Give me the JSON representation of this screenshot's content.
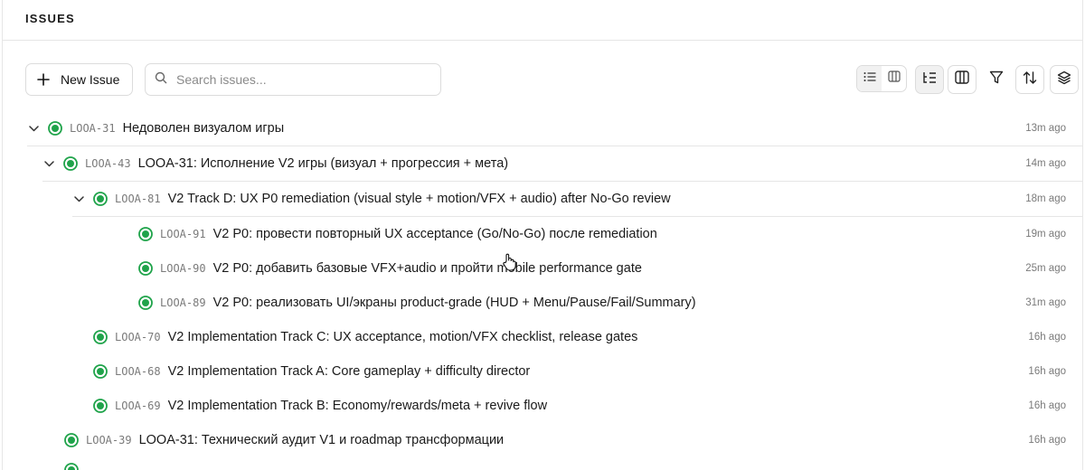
{
  "header": {
    "title": "ISSUES"
  },
  "toolbar": {
    "new_issue_label": "New Issue",
    "search_placeholder": "Search issues...",
    "icons": [
      "plus-icon",
      "search-icon",
      "list-view-icon",
      "board-view-icon",
      "nested-view-icon",
      "columns-icon",
      "filter-icon",
      "sort-icon",
      "layers-icon"
    ]
  },
  "colors": {
    "status_green": "#1fa34a",
    "border": "#e6e6e6",
    "muted": "#7a7a7a"
  },
  "issues": [
    {
      "id": "LOOA-31",
      "title": "Недоволен визуалом игры",
      "time": "13m ago",
      "expanded": true
    },
    {
      "id": "LOOA-43",
      "title": "LOOA-31: Исполнение V2 игры (визуал + прогрессия + мета)",
      "time": "14m ago",
      "expanded": true
    },
    {
      "id": "LOOA-81",
      "title": "V2 Track D: UX P0 remediation (visual style + motion/VFX + audio) after No-Go review",
      "time": "18m ago",
      "expanded": true
    },
    {
      "id": "LOOA-91",
      "title": "V2 P0: провести повторный UX acceptance (Go/No-Go) после remediation",
      "time": "19m ago"
    },
    {
      "id": "LOOA-90",
      "title": "V2 P0: добавить базовые VFX+audio и пройти mobile performance gate",
      "time": "25m ago"
    },
    {
      "id": "LOOA-89",
      "title": "V2 P0: реализовать UI/экраны product-grade (HUD + Menu/Pause/Fail/Summary)",
      "time": "31m ago"
    },
    {
      "id": "LOOA-70",
      "title": "V2 Implementation Track C: UX acceptance, motion/VFX checklist, release gates",
      "time": "16h ago"
    },
    {
      "id": "LOOA-68",
      "title": "V2 Implementation Track A: Core gameplay + difficulty director",
      "time": "16h ago"
    },
    {
      "id": "LOOA-69",
      "title": "V2 Implementation Track B: Economy/rewards/meta + revive flow",
      "time": "16h ago"
    },
    {
      "id": "LOOA-39",
      "title": "LOOA-31: Технический аудит V1 и roadmap трансформации",
      "time": "16h ago"
    }
  ]
}
